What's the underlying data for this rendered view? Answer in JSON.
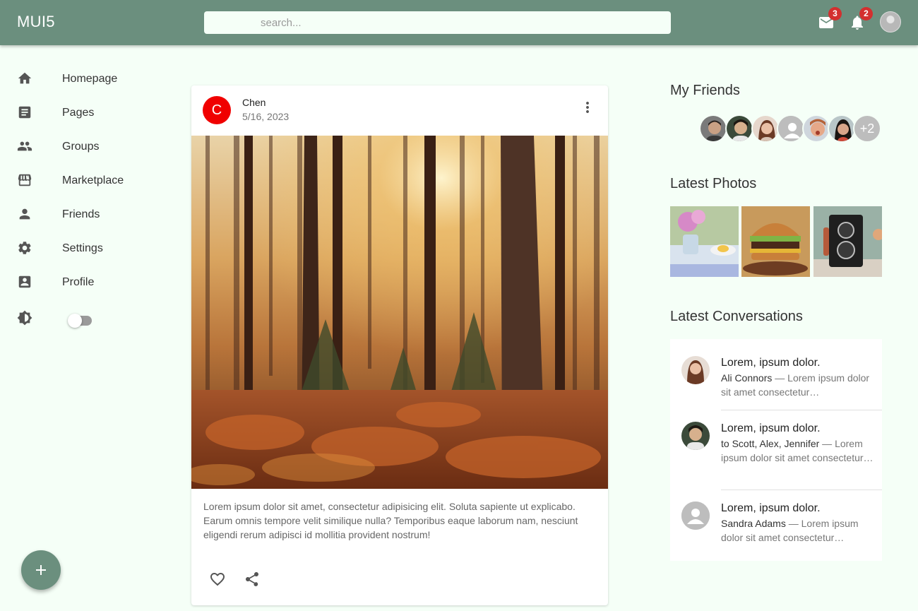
{
  "app": {
    "logo": "MUI5"
  },
  "header": {
    "search_placeholder": "search...",
    "mail_badge": "3",
    "notifications_badge": "2"
  },
  "sidebar": {
    "items": [
      {
        "label": "Homepage",
        "icon": "home-icon"
      },
      {
        "label": "Pages",
        "icon": "article-icon"
      },
      {
        "label": "Groups",
        "icon": "group-icon"
      },
      {
        "label": "Marketplace",
        "icon": "storefront-icon"
      },
      {
        "label": "Friends",
        "icon": "person-icon"
      },
      {
        "label": "Settings",
        "icon": "settings-icon"
      },
      {
        "label": "Profile",
        "icon": "account-box-icon"
      }
    ],
    "theme_toggle_on": false
  },
  "post": {
    "avatar_letter": "C",
    "author": "Chen",
    "date": "5/16, 2023",
    "text": "Lorem ipsum dolor sit amet, consectetur adipisicing elit. Soluta sapiente ut explicabo. Earum omnis tempore velit similique nulla? Temporibus eaque laborum nam, nesciunt eligendi rerum adipisci id mollitia provident nostrum!",
    "avatar_color": "#f00000"
  },
  "right": {
    "friends_title": "My Friends",
    "friends_more": "+2",
    "photos_title": "Latest Photos",
    "conversations_title": "Latest Conversations",
    "conversations": [
      {
        "primary": "Lorem, ipsum dolor.",
        "who": "Ali Connors",
        "snippet": " — Lorem ipsum dolor sit amet consectetur…"
      },
      {
        "primary": "Lorem, ipsum dolor.",
        "who": "to Scott, Alex, Jennifer",
        "snippet": " — Lorem ipsum dolor sit amet consectetur…"
      },
      {
        "primary": "Lorem, ipsum dolor.",
        "who": "Sandra Adams",
        "snippet": " — Lorem ipsum dolor sit amet consectetur…"
      }
    ]
  },
  "theme": {
    "primary": "#6b8f7e",
    "background": "#f5fff7",
    "badge": "#d32f2f"
  }
}
